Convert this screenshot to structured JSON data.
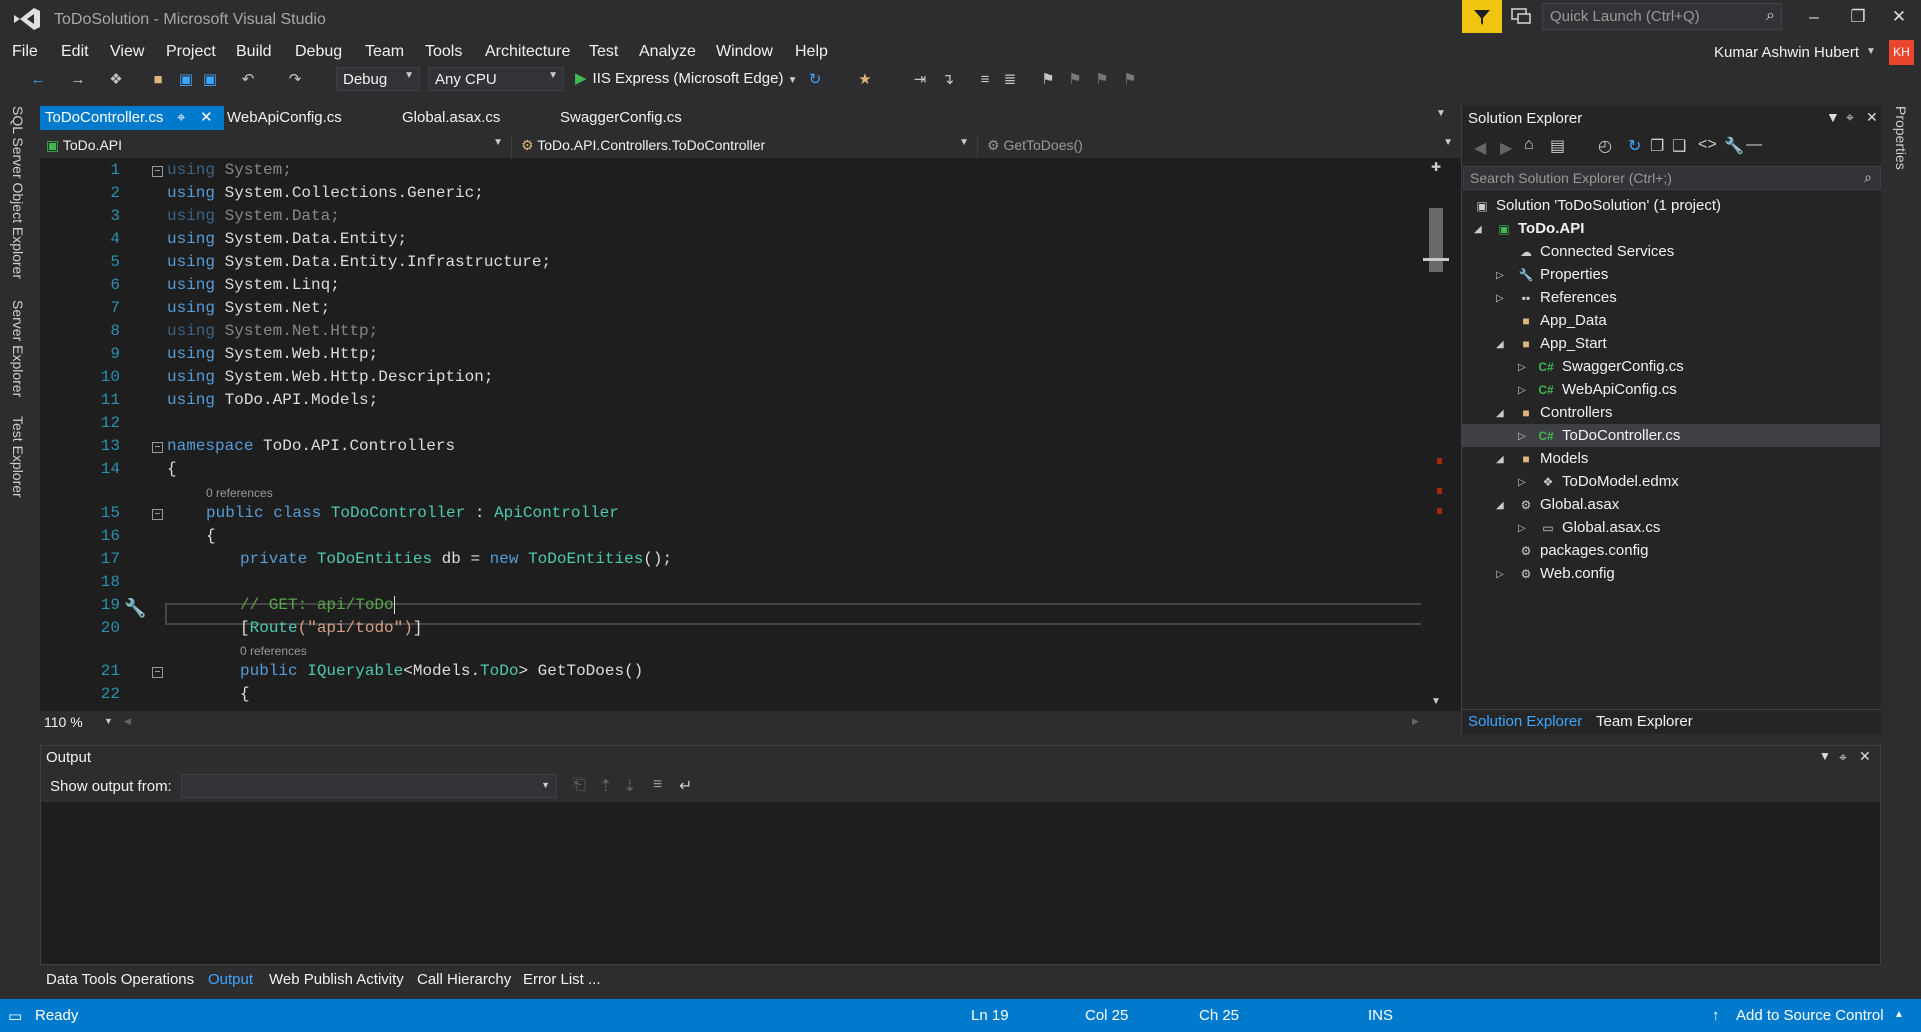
{
  "window": {
    "title": "ToDoSolution - Microsoft Visual Studio"
  },
  "quick_launch": {
    "placeholder": "Quick Launch (Ctrl+Q)"
  },
  "menu": [
    "File",
    "Edit",
    "View",
    "Project",
    "Build",
    "Debug",
    "Team",
    "Tools",
    "Architecture",
    "Test",
    "Analyze",
    "Window",
    "Help"
  ],
  "user": {
    "name": "Kumar Ashwin Hubert",
    "initials": "KH"
  },
  "toolbar": {
    "config": "Debug",
    "platform": "Any CPU",
    "run_target": "IIS Express (Microsoft Edge)"
  },
  "left_strip": [
    "SQL Server Object Explorer",
    "Server Explorer",
    "Test Explorer"
  ],
  "right_strip": [
    "Properties"
  ],
  "tabs": [
    "ToDoController.cs",
    "WebApiConfig.cs",
    "Global.asax.cs",
    "SwaggerConfig.cs"
  ],
  "nav": {
    "project": "ToDo.API",
    "class": "ToDo.API.Controllers.ToDoController",
    "member": "GetToDoes()"
  },
  "editor": {
    "line_numbers": [
      "1",
      "2",
      "3",
      "4",
      "5",
      "6",
      "7",
      "8",
      "9",
      "10",
      "11",
      "12",
      "13",
      "14",
      "15",
      "16",
      "17",
      "18",
      "19",
      "20",
      "21",
      "22"
    ],
    "codelens": [
      "0 references",
      "0 references"
    ],
    "zoom": "110 %",
    "lines": [
      {
        "kw": "using",
        "rest": " System;",
        "dim": true
      },
      {
        "kw": "using",
        "rest": " System.Collections.Generic;",
        "dim": false
      },
      {
        "kw": "using",
        "rest": " System.Data;",
        "dim": true
      },
      {
        "kw": "using",
        "rest": " System.Data.Entity;",
        "dim": false
      },
      {
        "kw": "using",
        "rest": " System.Data.Entity.Infrastructure;",
        "dim": false
      },
      {
        "kw": "using",
        "rest": " System.Linq;",
        "dim": false
      },
      {
        "kw": "using",
        "rest": " System.Net;",
        "dim": false
      },
      {
        "kw": "using",
        "rest": " System.Net.Http;",
        "dim": true
      },
      {
        "kw": "using",
        "rest": " System.Web.Http;",
        "dim": false
      },
      {
        "kw": "using",
        "rest": " System.Web.Http.Description;",
        "dim": false
      },
      {
        "kw": "using",
        "rest": " ToDo.API.Models;",
        "dim": false
      }
    ],
    "ns_kw": "namespace",
    "ns_name": " ToDo.API.Controllers",
    "brace_open": "{",
    "class_mod": "public class",
    "class_name": "ToDoController",
    "class_sep": " : ",
    "class_base": "ApiController",
    "field_kw": "private",
    "field_type": "ToDoEntities",
    "field_name": " db = ",
    "field_new": "new",
    "field_ctor": "ToDoEntities",
    "field_end": "();",
    "comment": "// GET: api/ToDo",
    "attr_open": "[",
    "attr_name": "Route",
    "attr_arg": "(\"api/todo\")",
    "attr_close": "]",
    "method_mod": "public",
    "method_type": "IQueryable",
    "method_gen_open": "<Models.",
    "method_gen_type": "ToDo",
    "method_gen_close": ">",
    "method_name": " GetToDoes()"
  },
  "solution_explorer": {
    "title": "Solution Explorer",
    "search_placeholder": "Search Solution Explorer (Ctrl+;)",
    "items": [
      {
        "label": "Solution 'ToDoSolution' (1 project)"
      },
      {
        "label": "ToDo.API"
      },
      {
        "label": "Connected Services"
      },
      {
        "label": "Properties"
      },
      {
        "label": "References"
      },
      {
        "label": "App_Data"
      },
      {
        "label": "App_Start"
      },
      {
        "label": "SwaggerConfig.cs"
      },
      {
        "label": "WebApiConfig.cs"
      },
      {
        "label": "Controllers"
      },
      {
        "label": "ToDoController.cs"
      },
      {
        "label": "Models"
      },
      {
        "label": "ToDoModel.edmx"
      },
      {
        "label": "Global.asax"
      },
      {
        "label": "Global.asax.cs"
      },
      {
        "label": "packages.config"
      },
      {
        "label": "Web.config"
      }
    ],
    "bottom_tabs": [
      "Solution Explorer",
      "Team Explorer"
    ]
  },
  "output": {
    "title": "Output",
    "show_from": "Show output from:"
  },
  "bottom_tabs": [
    "Data Tools Operations",
    "Output",
    "Web Publish Activity",
    "Call Hierarchy",
    "Error List ..."
  ],
  "status": {
    "state": "Ready",
    "ln": "Ln 19",
    "col": "Col 25",
    "ch": "Ch 25",
    "mode": "INS",
    "source_control": "Add to Source Control"
  },
  "colors": {
    "accent": "#007acc",
    "keyword": "#569cd6",
    "type": "#4ec9b0",
    "comment": "#57a64a",
    "string": "#d69d85",
    "linenum": "#2b91af"
  }
}
